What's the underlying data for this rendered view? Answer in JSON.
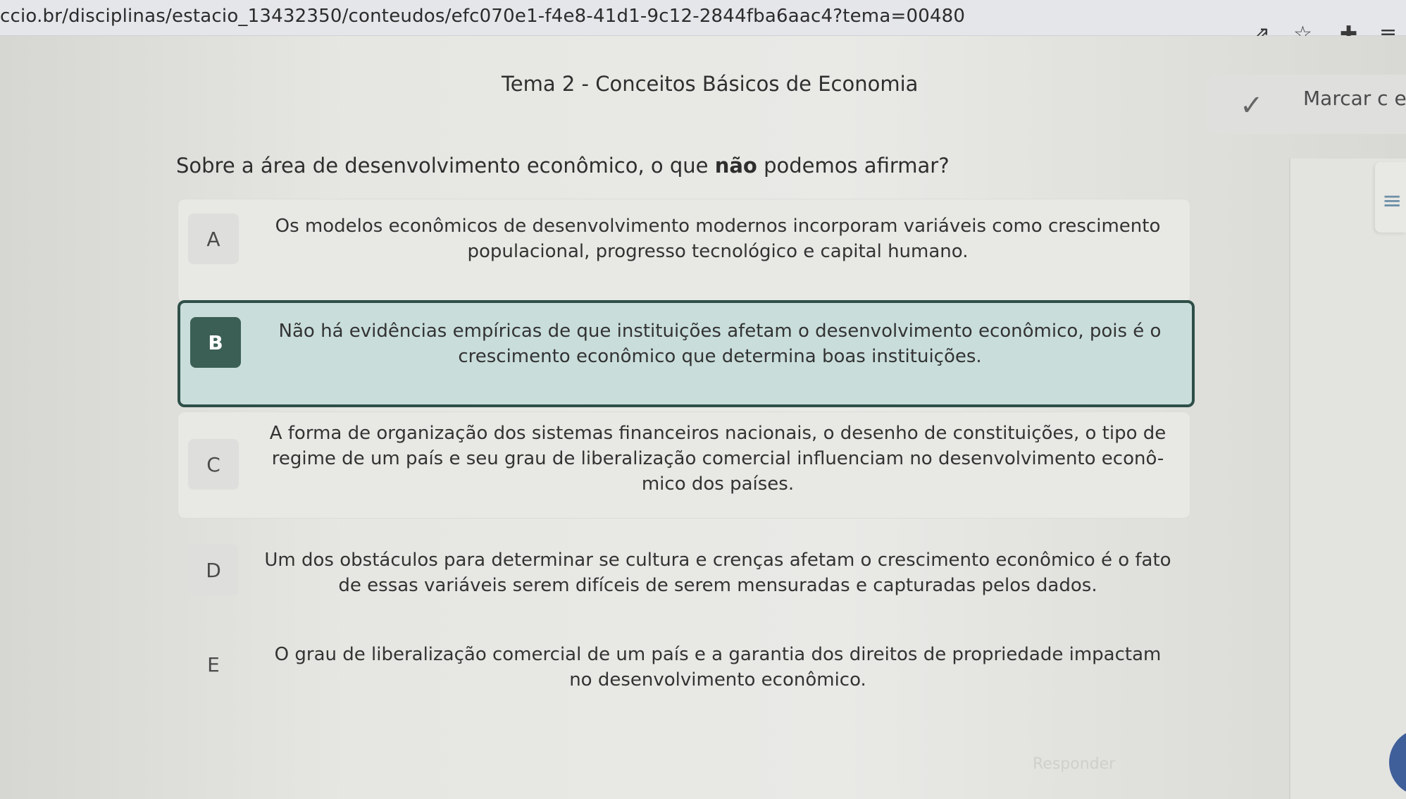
{
  "browser": {
    "url": "ccio.br/disciplinas/estacio_13432350/conteudos/efc070e1-f4e8-41d1-9c12-2844fba6aac4?tema=00480",
    "icons": [
      "share-icon",
      "star-icon",
      "extension-icon",
      "reading-list-icon"
    ]
  },
  "header": {
    "title": "Tema 2 - Conceitos Básicos de Economia",
    "mark_studied_label": "Marcar c estudado ("
  },
  "question": {
    "text_before": "Sobre a área de desenvolvimento econômico, o que ",
    "text_bold": "não",
    "text_after": " podemos afirmar?"
  },
  "options": [
    {
      "letter": "A",
      "text": "Os modelos econômicos de desenvolvimento modernos incorporam variáveis como crescimento populacional, progresso tecnológico e capital humano.",
      "selected": false
    },
    {
      "letter": "B",
      "text": "Não há evidências empíricas de que instituições afetam o desenvolvimento econômico, pois é o crescimento econômico que determina boas instituições.",
      "selected": true
    },
    {
      "letter": "C",
      "text": "A forma de organização dos sistemas financeiros nacionais, o desenho de constituições, o tipo de regime de um país e seu grau de liberalização comercial influenciam no desenvolvimento econô- mico dos países.",
      "selected": false
    },
    {
      "letter": "D",
      "text": "Um dos obstáculos para determinar se cultura e crenças afetam o crescimento econômico é o fato de essas variáveis serem difíceis de serem mensuradas e capturadas pelos dados.",
      "selected": false
    },
    {
      "letter": "E",
      "text": "O grau de liberalização comercial de um país e a garantia dos direitos de propriedade impactam no desenvolvimento econômico.",
      "selected": false
    }
  ],
  "footer": {
    "respond_label": "Responder"
  },
  "colors": {
    "selected_border": "#2e4f47",
    "selected_bg": "#c9dedb",
    "selected_letter_bg": "#3b5f55"
  }
}
